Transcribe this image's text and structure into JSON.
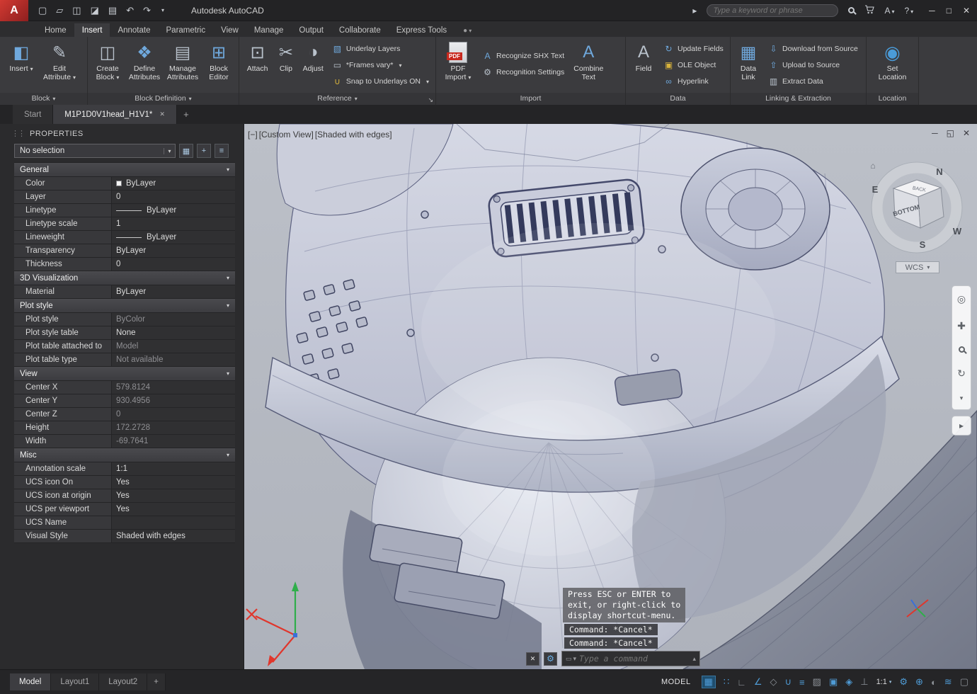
{
  "titlebar": {
    "title": "Autodesk AutoCAD",
    "search_placeholder": "Type a keyword or phrase"
  },
  "icons": {
    "logo": "A",
    "new_file": "▢",
    "open_folder": "▱",
    "save": "◫",
    "save_as": "◪",
    "plot": "▤",
    "undo": "↶",
    "redo": "↷",
    "menu_down": "▾",
    "search_arrow": "▸",
    "autodesk_a": "A",
    "help": "?",
    "win_min": "─",
    "win_max": "□",
    "win_close": "✕",
    "vp_min": "─",
    "vp_restore": "◱",
    "vp_close": "✕",
    "tab_close": "✕",
    "tab_new": "+",
    "options_circle": "●",
    "vc_home": "⌂",
    "nav_wheel": "◎",
    "nav_pan": "✚",
    "nav_orbit": "↻",
    "nav_more": "▾",
    "nav_motion": "▸",
    "qselect": "▦",
    "pickadd": "+",
    "qprops": "≡",
    "cmd_close": "✕",
    "cmd_custom": "⚙",
    "cmd_prompt_box": "▭",
    "cmd_recent": "▴",
    "launcher": "↘"
  },
  "status_icons": {
    "grid": "▦",
    "snap": "∷",
    "ortho": "∟",
    "polar": "∠",
    "isometric": "◇",
    "osnap": "∪",
    "lineweight": "≡",
    "transparency": "▨",
    "cycling": "▣",
    "osnap3d": "◈",
    "ducs": "⊥",
    "gear": "⚙",
    "monitor": "⊕",
    "isolate": "◐",
    "graphics": "≋",
    "clean": "▢"
  },
  "ribbon_icons": {
    "insert": "◧",
    "edit_attribute": "✎",
    "create_block": "◫",
    "define_attributes": "❖",
    "manage_attributes": "▤",
    "block_editor": "⊞",
    "attach": "⊡",
    "clip": "✂",
    "adjust": "◑",
    "underlay_layers": "▧",
    "frames": "▭",
    "snap_underlays": "∪",
    "pdf": "PDF",
    "recognize_shx": "A",
    "recognition_settings": "⚙",
    "combine_text": "A",
    "field": "A",
    "update_fields": "↻",
    "ole_object": "▣",
    "hyperlink": "∞",
    "data_link": "▦",
    "download": "⇩",
    "upload": "⇧",
    "extract": "▥",
    "set_location": "◉"
  },
  "ribbon": {
    "tabs": [
      "Home",
      "Insert",
      "Annotate",
      "Parametric",
      "View",
      "Manage",
      "Output",
      "Collaborate",
      "Express Tools"
    ],
    "panels": [
      {
        "name": "Block",
        "big": [
          {
            "label": "Insert"
          },
          {
            "label": "Edit Attribute"
          }
        ]
      },
      {
        "name": "Block Definition",
        "big": [
          {
            "label": "Create Block"
          },
          {
            "label": "Define Attributes"
          },
          {
            "label": "Manage Attributes"
          },
          {
            "label": "Block Editor"
          }
        ]
      },
      {
        "name": "Reference",
        "big": [
          {
            "label": "Attach"
          },
          {
            "label": "Clip"
          },
          {
            "label": "Adjust"
          }
        ],
        "small": [
          {
            "label": "Underlay Layers"
          },
          {
            "label": "*Frames vary*"
          },
          {
            "label": "Snap to Underlays ON"
          }
        ]
      },
      {
        "name": "Import",
        "big": [
          {
            "label": "PDF Import"
          },
          {
            "label": "Combine Text"
          }
        ],
        "small": [
          {
            "label": "Recognize SHX Text"
          },
          {
            "label": "Recognition Settings"
          }
        ]
      },
      {
        "name": "Data",
        "big": [
          {
            "label": "Field"
          }
        ],
        "small": [
          {
            "label": "Update Fields"
          },
          {
            "label": "OLE Object"
          },
          {
            "label": "Hyperlink"
          }
        ]
      },
      {
        "name": "Linking & Extraction",
        "big": [
          {
            "label": "Data Link"
          }
        ],
        "small": [
          {
            "label": "Download from Source"
          },
          {
            "label": "Upload to Source"
          },
          {
            "label": "Extract Data"
          }
        ]
      },
      {
        "name": "Location",
        "big": [
          {
            "label": "Set Location"
          }
        ]
      }
    ]
  },
  "doc_tabs": {
    "start": "Start",
    "drawing": "M1P1D0V1head_H1V1*"
  },
  "properties": {
    "header": "PROPERTIES",
    "selector": "No selection",
    "sections": [
      {
        "name": "General",
        "rows": [
          {
            "label": "Color",
            "value": "ByLayer"
          },
          {
            "label": "Layer",
            "value": "0"
          },
          {
            "label": "Linetype",
            "value": "ByLayer"
          },
          {
            "label": "Linetype scale",
            "value": "1"
          },
          {
            "label": "Lineweight",
            "value": "ByLayer"
          },
          {
            "label": "Transparency",
            "value": "ByLayer"
          },
          {
            "label": "Thickness",
            "value": "0"
          }
        ]
      },
      {
        "name": "3D Visualization",
        "rows": [
          {
            "label": "Material",
            "value": "ByLayer"
          }
        ]
      },
      {
        "name": "Plot style",
        "rows": [
          {
            "label": "Plot style",
            "value": "ByColor"
          },
          {
            "label": "Plot style table",
            "value": "None"
          },
          {
            "label": "Plot table attached to",
            "value": "Model"
          },
          {
            "label": "Plot table type",
            "value": "Not available"
          }
        ]
      },
      {
        "name": "View",
        "rows": [
          {
            "label": "Center X",
            "value": "579.8124"
          },
          {
            "label": "Center Y",
            "value": "930.4956"
          },
          {
            "label": "Center Z",
            "value": "0"
          },
          {
            "label": "Height",
            "value": "172.2728"
          },
          {
            "label": "Width",
            "value": "-69.7641"
          }
        ]
      },
      {
        "name": "Misc",
        "rows": [
          {
            "label": "Annotation scale",
            "value": "1:1"
          },
          {
            "label": "UCS icon On",
            "value": "Yes"
          },
          {
            "label": "UCS icon at origin",
            "value": "Yes"
          },
          {
            "label": "UCS per viewport",
            "value": "Yes"
          },
          {
            "label": "UCS Name",
            "value": ""
          },
          {
            "label": "Visual Style",
            "value": "Shaded with edges"
          }
        ]
      }
    ]
  },
  "viewport": {
    "controls": [
      "[−]",
      "[Custom View]",
      "[Shaded with edges]"
    ],
    "viewcube": {
      "n": "N",
      "e": "E",
      "s": "S",
      "w": "W",
      "front": "BOTTOM",
      "top": "BACK",
      "wcs": "WCS"
    },
    "command": {
      "tooltip": [
        "Press ESC or ENTER to",
        "exit, or right-click to",
        "display shortcut-menu."
      ],
      "history": [
        "Command: *Cancel*",
        "Command: *Cancel*"
      ],
      "placeholder": "Type a command"
    }
  },
  "statusbar": {
    "layout_tabs": [
      "Model",
      "Layout1",
      "Layout2"
    ],
    "model_label": "MODEL",
    "annotation_scale": "1:1"
  }
}
